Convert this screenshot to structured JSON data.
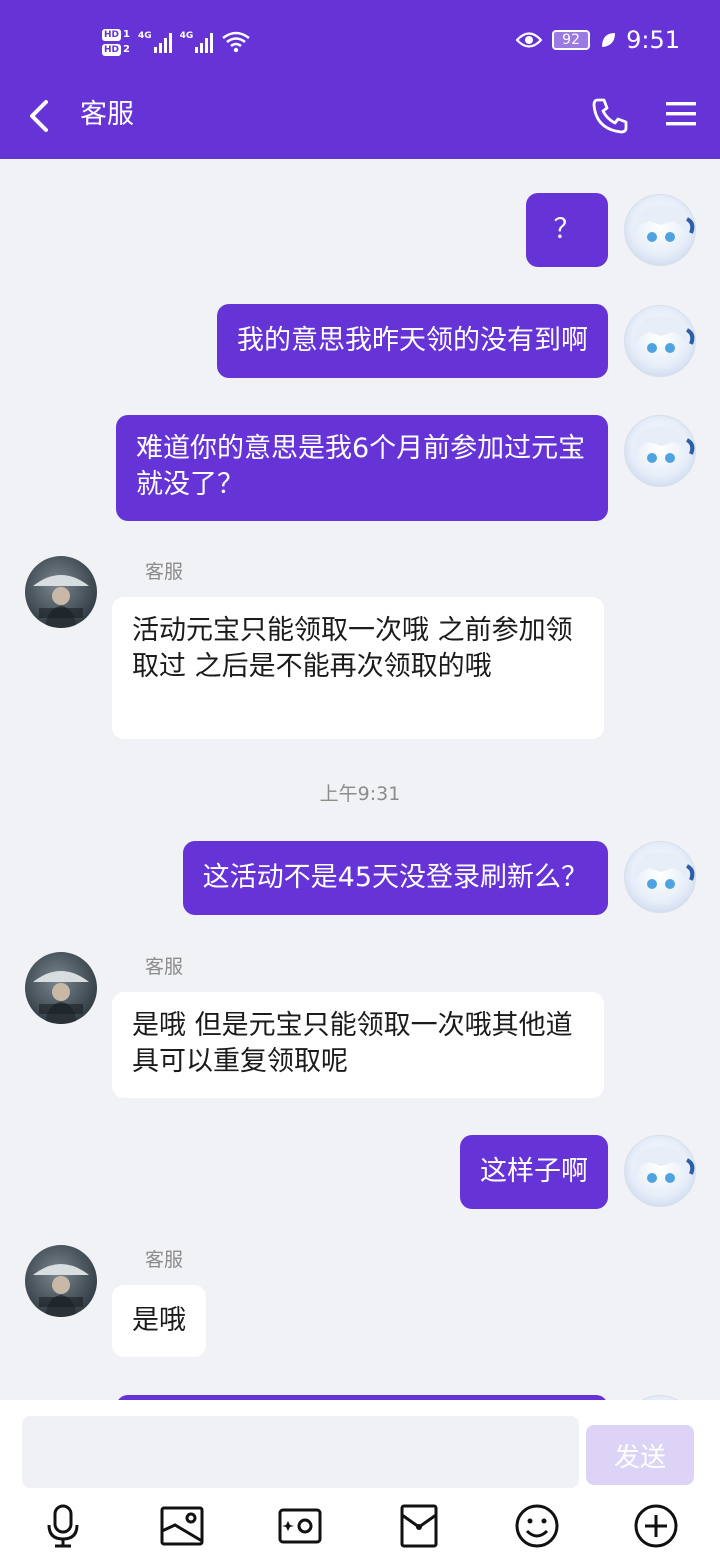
{
  "statusbar": {
    "hd1": "HD",
    "hd1_sub": "1",
    "hd2": "HD",
    "hd2_sub": "2",
    "net1": "4G",
    "net2": "4G",
    "battery": "92",
    "time": "9:51"
  },
  "header": {
    "title": "客服"
  },
  "messages": [
    {
      "dir": "out",
      "text": "？"
    },
    {
      "dir": "out",
      "text": "我的意思我昨天领的没有到啊"
    },
    {
      "dir": "out",
      "text": "难道你的意思是我6个月前参加过元宝就没了？"
    },
    {
      "dir": "in",
      "sender": "客服",
      "text": "活动元宝只能领取一次哦  之前参加领取过 之后是不能再次领取的哦"
    },
    {
      "timestamp": "上午9:31"
    },
    {
      "dir": "out",
      "text": "这活动不是45天没登录刷新么？"
    },
    {
      "dir": "in",
      "sender": "客服",
      "text": "是哦  但是元宝只能领取一次哦其他道具可以重复领取呢"
    },
    {
      "dir": "out",
      "text": "这样子啊"
    },
    {
      "dir": "in",
      "sender": "客服",
      "text": "是哦"
    }
  ],
  "composer": {
    "value": "",
    "send_label": "发送",
    "tools": [
      "mic-icon",
      "image-icon",
      "camera-icon",
      "red-packet-icon",
      "emoji-icon",
      "plus-icon"
    ]
  },
  "colors": {
    "accent": "#6633d6",
    "send_disabled": "#dcd3f7",
    "background": "#f1f2f6"
  }
}
